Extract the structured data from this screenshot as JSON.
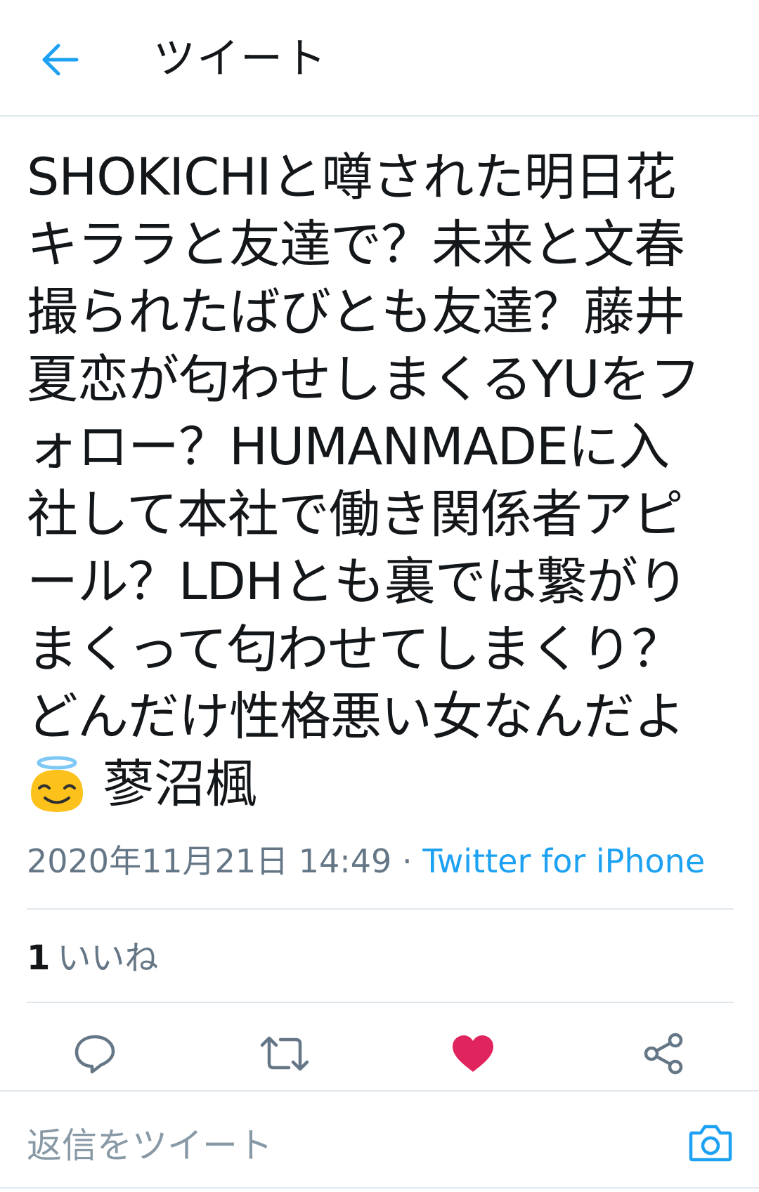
{
  "header": {
    "title": "ツイート",
    "back_icon": "arrow-left-icon"
  },
  "tweet": {
    "lines": [
      "SHOKICHIと噂された明日花",
      "キララと友達で？未来と文春",
      "撮られたばびとも友達？藤井",
      "夏恋が匂わせしまくるYUをフ",
      "ォロー？HUMANMADEに入",
      "社して本社で働き関係者アピ",
      "ール？LDHとも裏では繋がり",
      "まくって匂わせてしまくり？",
      "どんだけ性格悪い女なんだよ"
    ],
    "emoji": "smiling-face-with-halo-icon",
    "last_text": "蓼沼楓",
    "timestamp": "2020年11月21日 14:49",
    "separator": " · ",
    "source": "Twitter for iPhone"
  },
  "likes": {
    "count": "1",
    "label": "いいね"
  },
  "actions": {
    "reply_icon": "reply-icon",
    "retweet_icon": "retweet-icon",
    "like_icon": "heart-icon",
    "share_icon": "share-icon",
    "like_color": "#e0245e",
    "icon_color": "#657786"
  },
  "reply_bar": {
    "placeholder": "返信をツイート",
    "camera_icon": "camera-icon"
  },
  "colors": {
    "accent": "#1da1f2",
    "text": "#14171a",
    "muted": "#657786",
    "divider": "#e1e8ed"
  }
}
